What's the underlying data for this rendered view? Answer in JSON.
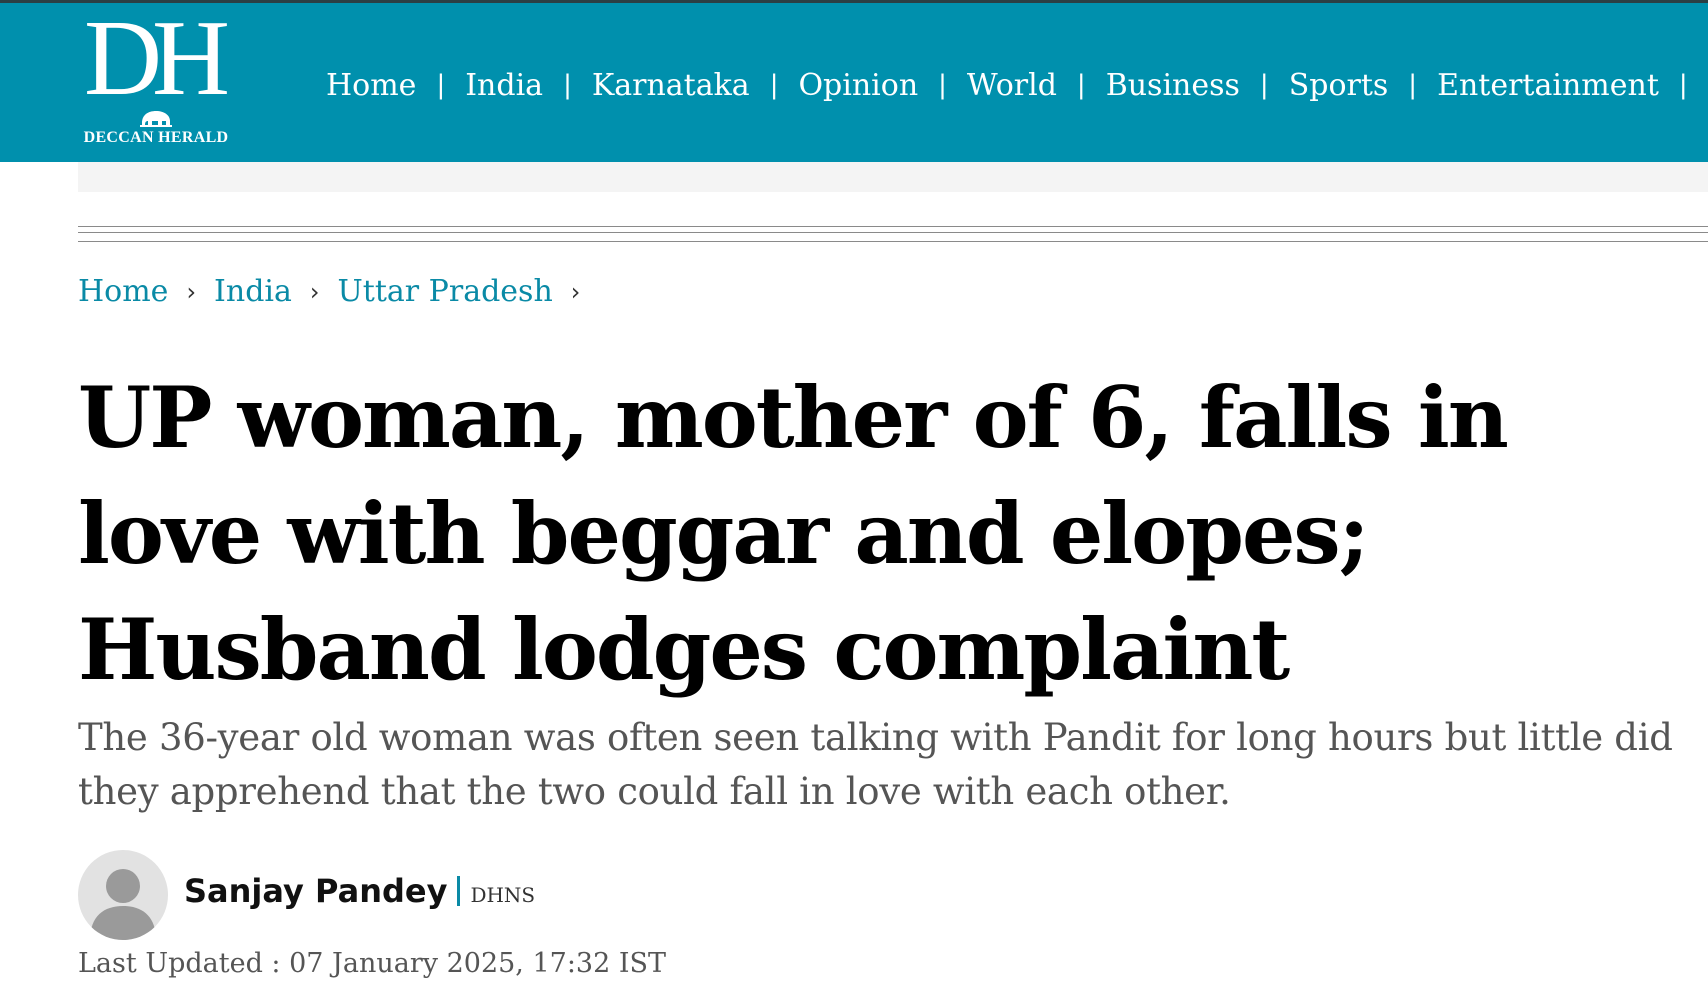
{
  "header": {
    "logo_mark": "DH",
    "logo_text": "DECCAN HERALD",
    "nav": [
      "Home",
      "India",
      "Karnataka",
      "Opinion",
      "World",
      "Business",
      "Sports",
      "Entertainment"
    ],
    "background_color": "#0090ad"
  },
  "breadcrumb": [
    "Home",
    "India",
    "Uttar Pradesh"
  ],
  "article": {
    "headline": "UP woman, mother of 6, falls in love with beggar and elopes; Husband lodges complaint",
    "summary": "The 36-year old woman was often seen talking with Pandit for long hours but little did they apprehend that the two could fall in love with each other.",
    "author": "Sanjay Pandey",
    "source": "DHNS",
    "last_updated": "Last Updated : 07 January 2025, 17:32 IST"
  },
  "colors": {
    "accent": "#0a8aa6",
    "headline": "#000000",
    "summary": "#555555"
  }
}
